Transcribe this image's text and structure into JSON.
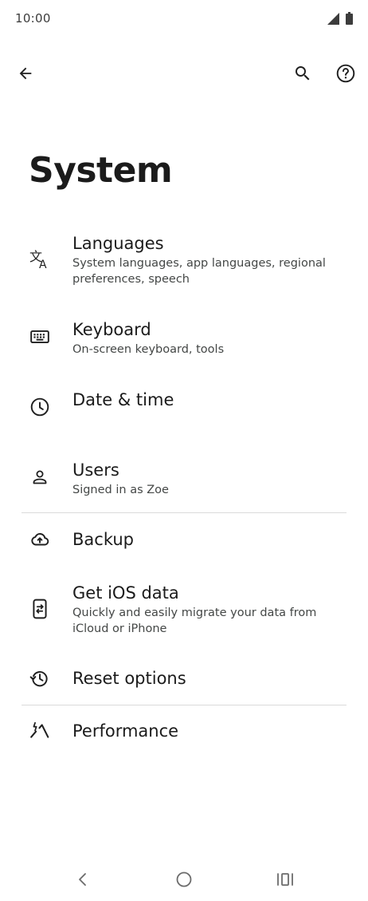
{
  "status_bar": {
    "time": "10:00",
    "icons": [
      "signal-icon",
      "battery-icon"
    ]
  },
  "app_bar": {
    "back_icon": "arrow-left-icon",
    "search_icon": "search-icon",
    "help_icon": "help-circle-icon"
  },
  "page": {
    "title": "System"
  },
  "settings": [
    {
      "title": "Languages",
      "subtitle": "System languages, app languages, regional preferences, speech",
      "icon": "translate-icon"
    },
    {
      "title": "Keyboard",
      "subtitle": "On-screen keyboard, tools",
      "icon": "keyboard-icon"
    },
    {
      "title": "Date & time",
      "subtitle": "",
      "icon": "clock-icon"
    },
    {
      "title": "Users",
      "subtitle": "Signed in as Zoe",
      "icon": "person-icon"
    },
    {
      "title": "Backup",
      "subtitle": "",
      "icon": "cloud-upload-icon"
    },
    {
      "title": "Get iOS data",
      "subtitle": "Quickly and easily migrate your data from iCloud or iPhone",
      "icon": "phone-transfer-icon"
    },
    {
      "title": "Reset options",
      "subtitle": "",
      "icon": "history-icon"
    },
    {
      "title": "Performance",
      "subtitle": "",
      "icon": "performance-icon"
    }
  ],
  "nav_bar": {
    "icons": [
      "nav-back-icon",
      "nav-home-icon",
      "nav-recents-icon"
    ]
  },
  "colors": {
    "background": "#ffffff",
    "text_primary": "#1b1b1b",
    "text_secondary": "#444746",
    "divider": "#dadada",
    "icon": "#1f1f1f"
  }
}
